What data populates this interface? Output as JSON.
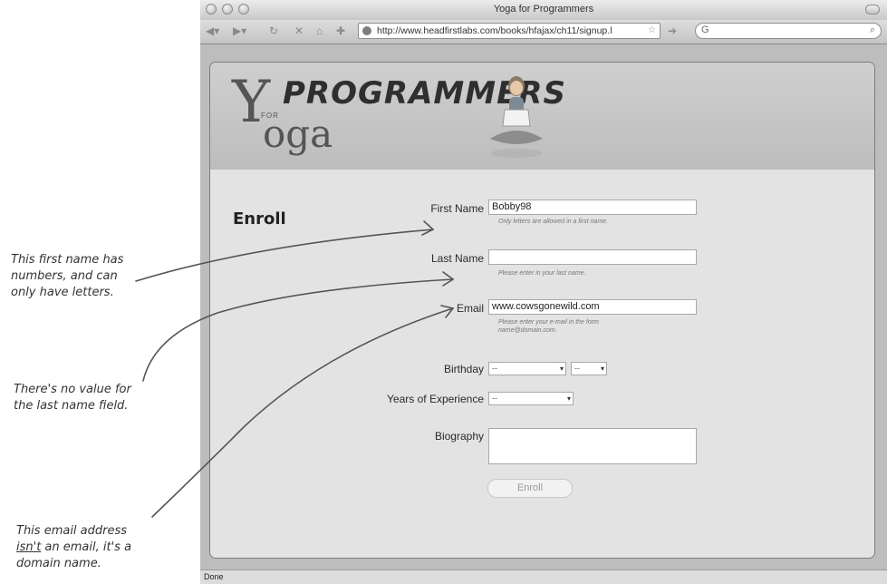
{
  "browser": {
    "title": "Yoga for Programmers",
    "url": "http://www.headfirstlabs.com/books/hfajax/ch11/signup.l",
    "search_engine_icon": "G",
    "status": "Done"
  },
  "site": {
    "logo_y": "Y",
    "logo_for": "FOR",
    "logo_oga": "oga",
    "logo_programmers": "PROGRAMMERS",
    "section_title": "Enroll"
  },
  "form": {
    "first_name": {
      "label": "First Name",
      "value": "Bobby98",
      "hint": "Only letters are allowed in a first name."
    },
    "last_name": {
      "label": "Last Name",
      "value": "",
      "hint": "Please enter in your last name."
    },
    "email": {
      "label": "Email",
      "value": "www.cowsgonewild.com",
      "hint_line1": "Please enter your e-mail in the form",
      "hint_line2": "name@domain.com."
    },
    "birthday": {
      "label": "Birthday",
      "month_value": "--",
      "day_value": "--"
    },
    "experience": {
      "label": "Years of Experience",
      "value": "--"
    },
    "biography": {
      "label": "Biography",
      "value": ""
    },
    "submit_label": "Enroll"
  },
  "annotations": {
    "first": [
      "This first name has",
      "numbers, and can",
      "only have letters."
    ],
    "second": [
      "There's no value for",
      "the last name field."
    ],
    "third_line1": "This email address",
    "third_line2_underlined": "isn't",
    "third_line2_rest": " an email, it's a",
    "third_line3": "domain name."
  }
}
